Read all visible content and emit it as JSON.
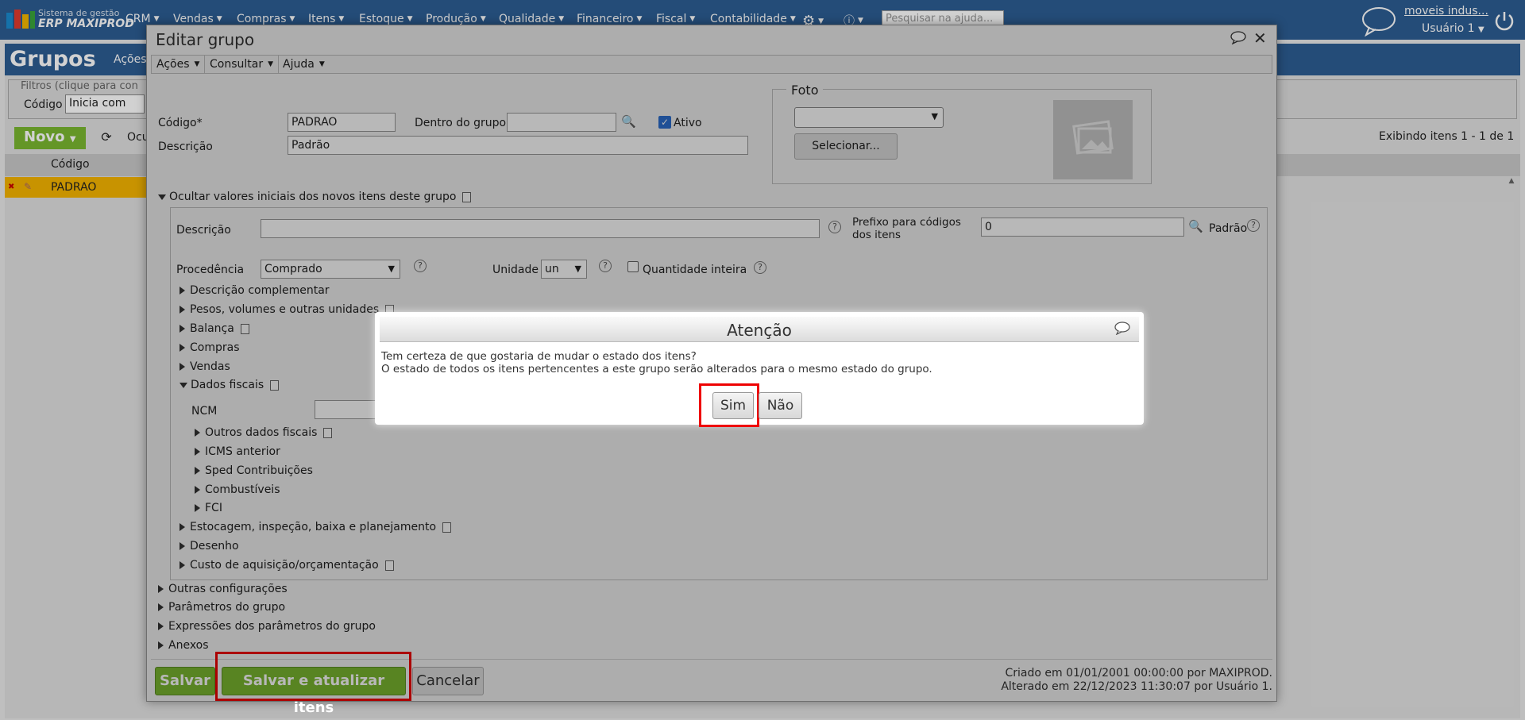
{
  "topbar": {
    "logo_line1": "Sistema de gestão",
    "logo_line2": "ERP MAXIPROD",
    "menu": [
      "CRM",
      "Vendas",
      "Compras",
      "Itens",
      "Estoque",
      "Produção",
      "Qualidade",
      "Financeiro",
      "Fiscal",
      "Contabilidade"
    ],
    "help_placeholder": "Pesquisar na ajuda...",
    "company": "moveis indus...",
    "user": "Usuário 1"
  },
  "background_page": {
    "title": "Grupos",
    "acoes": "Ações",
    "filters_legend": "Filtros (clique para con",
    "code_label": "Código",
    "code_select": "Inicia com",
    "new_button": "Novo",
    "ocu_label": "Ocu",
    "showing": "Exibindo itens 1 - 1 de 1",
    "col_code": "Código",
    "row_code": "PADRAO"
  },
  "dialog": {
    "title": "Editar grupo",
    "toolbar": [
      "Ações",
      "Consultar",
      "Ajuda"
    ],
    "codigo_label": "Código*",
    "codigo_value": "PADRAO",
    "dentro_label": "Dentro do grupo",
    "ativo_label": "Ativo",
    "descricao_label": "Descrição",
    "descricao_value": "Padrão",
    "foto_legend": "Foto",
    "foto_button": "Selecionar...",
    "initial_values_section": "Ocultar valores iniciais dos novos itens deste grupo",
    "item_desc_label": "Descrição",
    "prefix_label_1": "Prefixo para códigos",
    "prefix_label_2": "dos itens",
    "prefix_value": "0",
    "padrao_label": "Padrão",
    "procedencia_label": "Procedência",
    "procedencia_value": "Comprado",
    "unidade_label": "Unidade",
    "unidade_value": "un",
    "qtd_inteira_label": "Quantidade inteira",
    "sections": [
      "Descrição complementar",
      "Pesos, volumes e outras unidades",
      "Balança",
      "Compras",
      "Vendas",
      "Dados fiscais"
    ],
    "ncm_label": "NCM",
    "fiscal_subsections": [
      "Outros dados fiscais",
      "ICMS anterior",
      "Sped Contribuições",
      "Combustíveis",
      "FCI"
    ],
    "more_sections": [
      "Estocagem, inspeção, baixa e planejamento",
      "Desenho",
      "Custo de aquisição/orçamentação"
    ],
    "outer_sections": [
      "Outras configurações",
      "Parâmetros do grupo",
      "Expressões dos parâmetros do grupo",
      "Anexos"
    ],
    "btn_save": "Salvar",
    "btn_save_update": "Salvar e atualizar itens",
    "btn_cancel": "Cancelar",
    "created": "Criado em 01/01/2001 00:00:00 por MAXIPROD.",
    "modified": "Alterado em 22/12/2023 11:30:07 por Usuário 1."
  },
  "attention": {
    "title": "Atenção",
    "line1": "Tem certeza de que gostaria de mudar o estado dos itens?",
    "line2": "O estado de todos os itens pertencentes a este grupo serão alterados para o mesmo estado do grupo.",
    "yes": "Sim",
    "no": "Não"
  },
  "colors": {
    "brand": "#2d5d93",
    "green": "#7ab730",
    "highlight": "#e00000",
    "selected_row": "#f4b400"
  }
}
